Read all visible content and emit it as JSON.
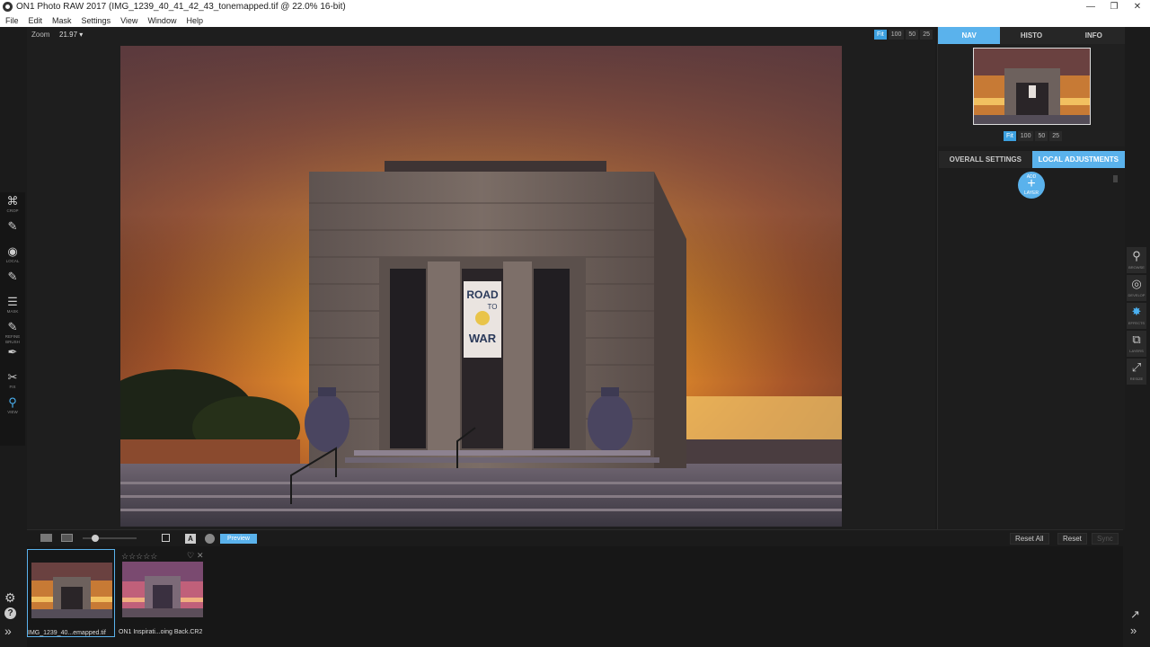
{
  "window": {
    "title": "ON1 Photo RAW 2017 (IMG_1239_40_41_42_43_tonemapped.tif @ 22.0% 16-bit)",
    "minimize": "—",
    "maximize": "❐",
    "close": "✕"
  },
  "menu": [
    "File",
    "Edit",
    "Mask",
    "Settings",
    "View",
    "Window",
    "Help"
  ],
  "canvas": {
    "zoom_label": "Zoom",
    "zoom_value": "21.97",
    "zoom_buttons": [
      "Fit",
      "100",
      "50",
      "25"
    ],
    "zoom_active": "Fit"
  },
  "photo": {
    "sign_lines": [
      "ROAD",
      "TO",
      "WAR"
    ]
  },
  "tools": [
    {
      "label": "CROP",
      "icon": "crop-icon",
      "glyph": "⌘"
    },
    {
      "label": "",
      "icon": "brush-icon",
      "glyph": "✎"
    },
    {
      "label": "LOCAL",
      "icon": "local-adjust-icon",
      "glyph": "◉"
    },
    {
      "label": "",
      "icon": "masking-brush-icon",
      "glyph": "✎"
    },
    {
      "label": "MASK",
      "icon": "mask-icon",
      "glyph": "☰"
    },
    {
      "label": "REFINE BRUSH",
      "icon": "refine-brush-icon",
      "glyph": "✎"
    },
    {
      "label": "",
      "icon": "retouch-icon",
      "glyph": "✒"
    },
    {
      "label": "FIX",
      "icon": "fix-icon",
      "glyph": "✂"
    },
    {
      "label": "VIEW",
      "icon": "magnifier-icon",
      "glyph": "⚲"
    }
  ],
  "panel": {
    "tabs": [
      "NAV",
      "HISTO",
      "INFO"
    ],
    "active_tab": "NAV",
    "nav_zoom": [
      "Fit",
      "100",
      "50",
      "25"
    ],
    "settings_tabs": [
      "OVERALL SETTINGS",
      "LOCAL ADJUSTMENTS"
    ],
    "active_settings_tab": "LOCAL ADJUSTMENTS",
    "add_layer_top": "ADD",
    "add_layer_plus": "+",
    "add_layer_bottom": "LAYER"
  },
  "modules": [
    {
      "label": "BROWSE",
      "icon": "browse-icon",
      "glyph": "⚲"
    },
    {
      "label": "DEVELOP",
      "icon": "develop-icon",
      "glyph": "◎"
    },
    {
      "label": "EFFECTS",
      "icon": "effects-icon",
      "glyph": "✸"
    },
    {
      "label": "LAYERS",
      "icon": "layers-icon",
      "glyph": "⧉"
    },
    {
      "label": "RESIZE",
      "icon": "resize-icon",
      "glyph": "⤢"
    }
  ],
  "bottom": {
    "preview_label": "Preview",
    "badge_a": "A",
    "reset_all": "Reset All",
    "reset": "Reset",
    "sync": "Sync"
  },
  "filmstrip": [
    {
      "name": "IMG_1239_40...emapped.tif",
      "selected": true
    },
    {
      "name": "ON1 Inspirati...oing Back.CR2",
      "selected": false,
      "stars": "☆☆☆☆☆",
      "heart": "♡",
      "x": "✕"
    }
  ],
  "colors": {
    "accent": "#5ab2ec",
    "background": "#1b1b1b"
  }
}
